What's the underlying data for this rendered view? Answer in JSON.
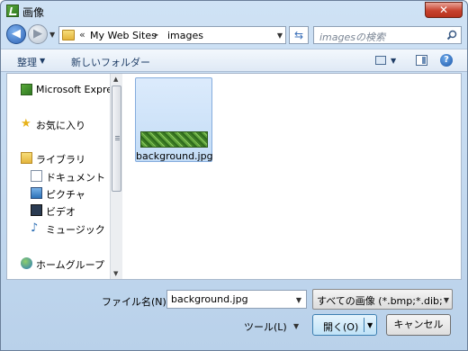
{
  "window": {
    "title": "画像",
    "close_label": "✕"
  },
  "address": {
    "overflow": "«",
    "crumbs": [
      "My Web Sites",
      "images"
    ],
    "separator": "▸"
  },
  "search": {
    "placeholder": "imagesの検索"
  },
  "toolbar": {
    "organize": "整理",
    "new_folder": "新しいフォルダー",
    "help": "?"
  },
  "navpane": {
    "items": [
      {
        "label": "Microsoft Express",
        "icon": "expression-web-icon"
      },
      {
        "label": "お気に入り",
        "icon": "star-icon"
      },
      {
        "label": "ライブラリ",
        "icon": "library-icon"
      },
      {
        "label": "ドキュメント",
        "icon": "documents-icon"
      },
      {
        "label": "ピクチャ",
        "icon": "pictures-icon"
      },
      {
        "label": "ビデオ",
        "icon": "videos-icon"
      },
      {
        "label": "ミュージック",
        "icon": "music-icon"
      },
      {
        "label": "ホームグループ",
        "icon": "homegroup-icon"
      }
    ]
  },
  "files": [
    {
      "name": "background.jpg",
      "selected": true
    }
  ],
  "bottom": {
    "filename_label": "ファイル名(N):",
    "filename_value": "background.jpg",
    "filetype_value": "すべての画像 (*.bmp;*.dib;*",
    "tools_label": "ツール(L)",
    "open_label": "開く(O)",
    "cancel_label": "キャンセル"
  },
  "colors": {
    "accent": "#3c7fb1",
    "selection": "#c3dcf6",
    "close": "#c7422e"
  }
}
